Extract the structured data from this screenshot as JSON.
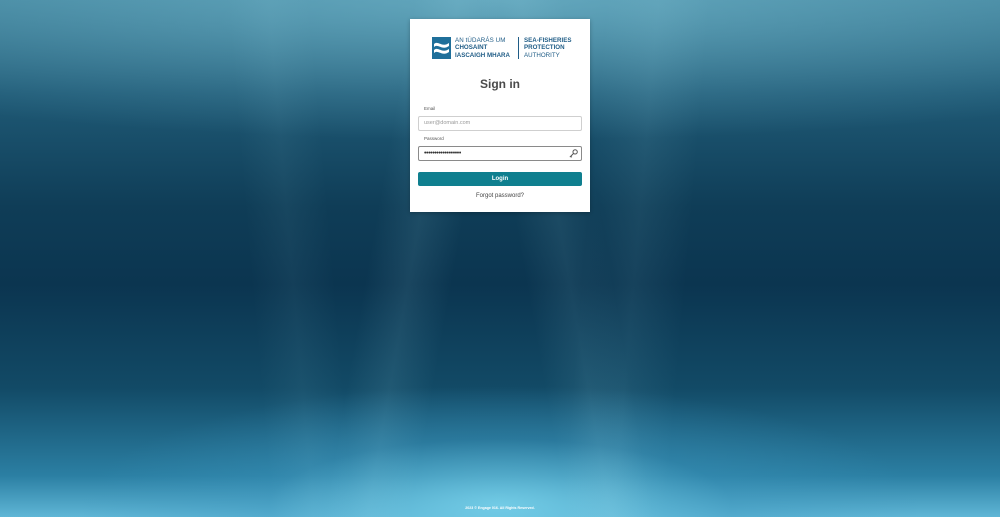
{
  "logo": {
    "irish_line1": "AN tÚDARÁS UM",
    "irish_line2": "CHOSAINT",
    "irish_line3": "IASCAIGH MHARA",
    "english_line1": "SEA-FISHERIES",
    "english_line2": "PROTECTION",
    "english_line3": "AUTHORITY",
    "icon": "wave-logo-icon",
    "brand_color": "#1f5c86"
  },
  "form": {
    "title": "Sign in",
    "email_label": "Email",
    "email_placeholder": "user@domain.com",
    "password_label": "Password",
    "password_value": "••••••••••••••••••",
    "password_icon": "key-icon",
    "login_label": "Login",
    "login_color": "#0f7f8f",
    "forgot_label": "Forgot password?"
  },
  "footer": {
    "text": "2023 © Engage 016. All Rights Reserved."
  }
}
